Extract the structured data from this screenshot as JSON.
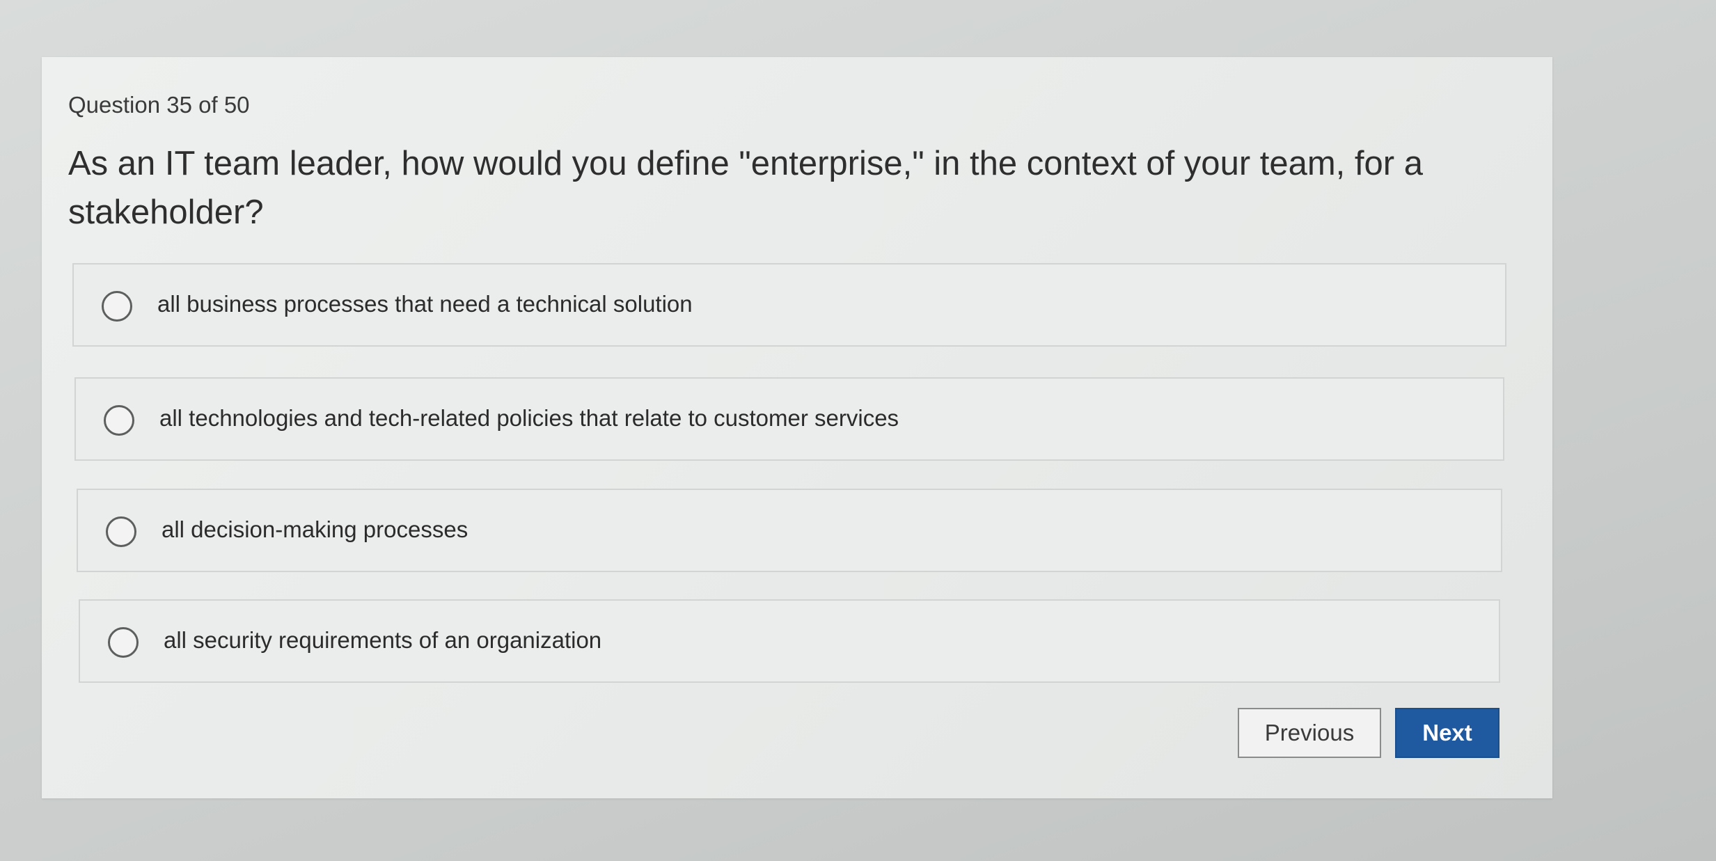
{
  "quiz": {
    "counter": "Question 35 of 50",
    "question": "As an IT team leader, how would you define \"enterprise,\" in the context of your team, for a stakeholder?",
    "options": [
      {
        "label": "all business processes that need a technical solution"
      },
      {
        "label": "all technologies and tech-related policies that relate to customer services"
      },
      {
        "label": "all decision-making processes"
      },
      {
        "label": "all security requirements of an organization"
      }
    ],
    "buttons": {
      "previous": "Previous",
      "next": "Next"
    }
  },
  "colors": {
    "next_button": "#1f5aa0",
    "background": "#d9dcdb",
    "card": "#eceeed"
  }
}
